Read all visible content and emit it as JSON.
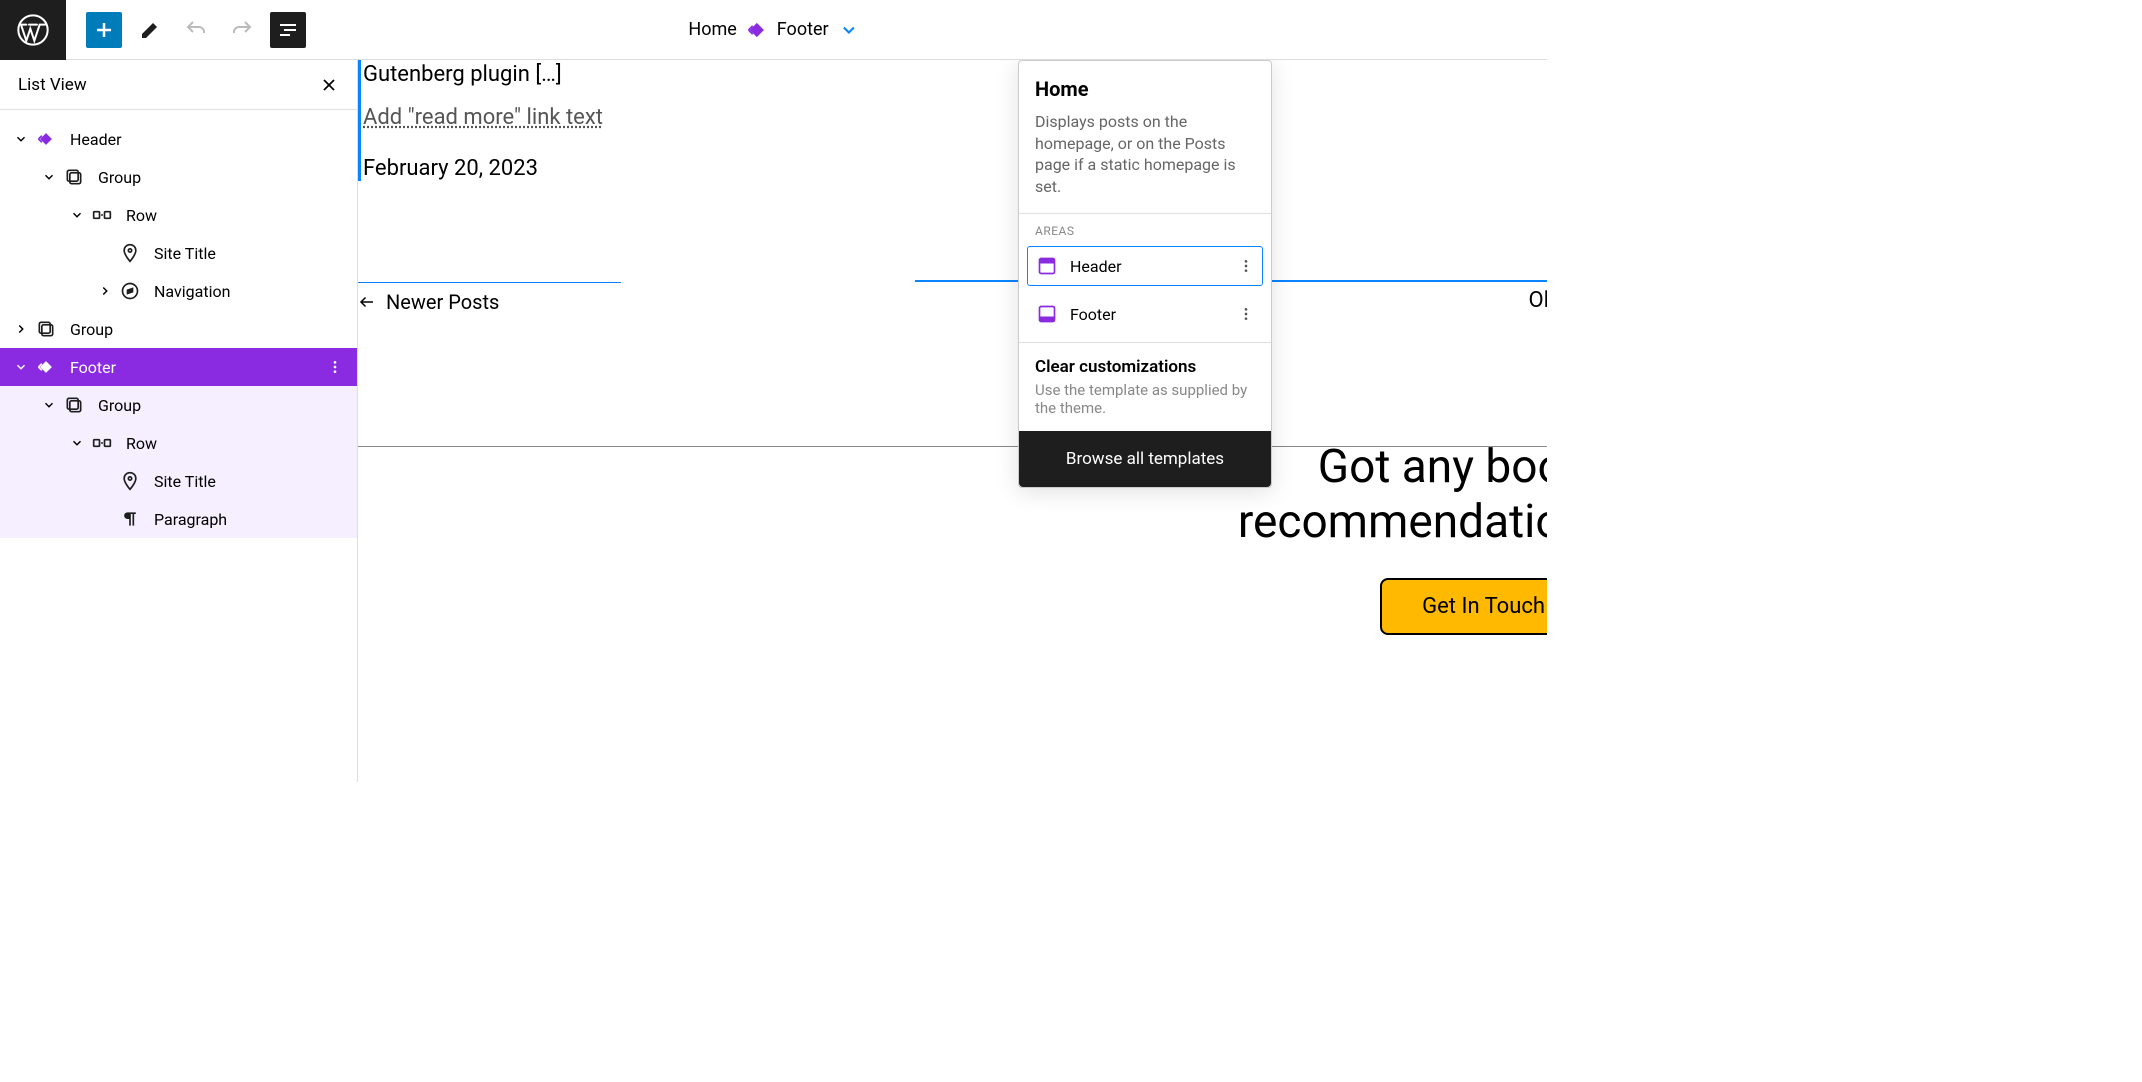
{
  "topbar": {
    "breadcrumb_home": "Home",
    "breadcrumb_current": "Footer"
  },
  "sidebar": {
    "title": "List View",
    "items": [
      {
        "label": "Header",
        "indent": 0,
        "chev": "d",
        "icon": "diamond"
      },
      {
        "label": "Group",
        "indent": 1,
        "chev": "d",
        "icon": "group"
      },
      {
        "label": "Row",
        "indent": 2,
        "chev": "d",
        "icon": "row"
      },
      {
        "label": "Site Title",
        "indent": 3,
        "chev": "",
        "icon": "pin"
      },
      {
        "label": "Navigation",
        "indent": 3,
        "chev": "r",
        "icon": "compass"
      },
      {
        "label": "Group",
        "indent": 0,
        "chev": "r",
        "icon": "group"
      },
      {
        "label": "Footer",
        "indent": 0,
        "chev": "d",
        "icon": "diamond",
        "selected": true
      },
      {
        "label": "Group",
        "indent": 1,
        "chev": "d",
        "icon": "group"
      },
      {
        "label": "Row",
        "indent": 2,
        "chev": "d",
        "icon": "row"
      },
      {
        "label": "Site Title",
        "indent": 3,
        "chev": "",
        "icon": "pin"
      },
      {
        "label": "Paragraph",
        "indent": 3,
        "chev": "",
        "icon": "paragraph"
      }
    ]
  },
  "canvas": {
    "post_title": "Gutenberg plugin […]",
    "read_more": "Add \"read more\" link text",
    "post_date": "February 20, 2023",
    "newer_posts": "Newer Posts",
    "ol_text": "Ol",
    "footer_line1": "Got any book",
    "footer_line2": "recommendation",
    "cta": "Get In Touch"
  },
  "popover": {
    "title": "Home",
    "desc": "Displays posts on the homepage, or on the Posts page if a static homepage is set.",
    "areas_label": "AREAS",
    "areas": [
      {
        "label": "Header"
      },
      {
        "label": "Footer"
      }
    ],
    "clear_title": "Clear customizations",
    "clear_desc": "Use the template as supplied by the theme.",
    "browse": "Browse all templates"
  }
}
